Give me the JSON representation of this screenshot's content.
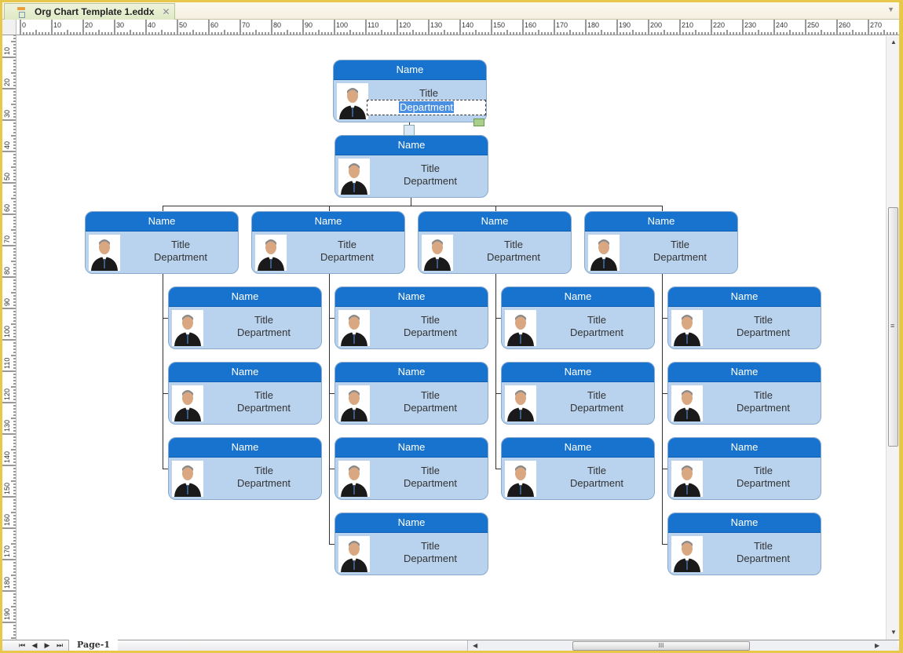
{
  "window": {
    "tab_title": "Org Chart Template 1.eddx",
    "close_glyph": "✕",
    "menu_glyph": "▼"
  },
  "rulers": {
    "horizontal_labels": [
      "0",
      "10",
      "20",
      "30",
      "40",
      "50",
      "60",
      "70",
      "80",
      "90",
      "100",
      "110",
      "120",
      "130",
      "140",
      "150",
      "160",
      "170",
      "180",
      "190",
      "200",
      "210",
      "220",
      "230",
      "240",
      "250",
      "260",
      "270"
    ],
    "vertical_labels": [
      "10",
      "20",
      "30",
      "40",
      "50",
      "60",
      "70",
      "80",
      "90",
      "100",
      "110",
      "120",
      "130",
      "140",
      "150",
      "160",
      "170",
      "180",
      "190"
    ]
  },
  "chart": {
    "root": {
      "name": "Name",
      "title": "Title",
      "department": "Department",
      "editing": true
    },
    "level1": {
      "name": "Name",
      "title": "Title",
      "department": "Department"
    },
    "managers": [
      {
        "name": "Name",
        "title": "Title",
        "department": "Department",
        "reports": [
          {
            "name": "Name",
            "title": "Title",
            "department": "Department"
          },
          {
            "name": "Name",
            "title": "Title",
            "department": "Department"
          },
          {
            "name": "Name",
            "title": "Title",
            "department": "Department"
          }
        ]
      },
      {
        "name": "Name",
        "title": "Title",
        "department": "Department",
        "reports": [
          {
            "name": "Name",
            "title": "Title",
            "department": "Department"
          },
          {
            "name": "Name",
            "title": "Title",
            "department": "Department"
          },
          {
            "name": "Name",
            "title": "Title",
            "department": "Department"
          },
          {
            "name": "Name",
            "title": "Title",
            "department": "Department"
          }
        ]
      },
      {
        "name": "Name",
        "title": "Title",
        "department": "Department",
        "reports": [
          {
            "name": "Name",
            "title": "Title",
            "department": "Department"
          },
          {
            "name": "Name",
            "title": "Title",
            "department": "Department"
          },
          {
            "name": "Name",
            "title": "Title",
            "department": "Department"
          }
        ]
      },
      {
        "name": "Name",
        "title": "Title",
        "department": "Department",
        "reports": [
          {
            "name": "Name",
            "title": "Title",
            "department": "Department"
          },
          {
            "name": "Name",
            "title": "Title",
            "department": "Department"
          },
          {
            "name": "Name",
            "title": "Title",
            "department": "Department"
          },
          {
            "name": "Name",
            "title": "Title",
            "department": "Department"
          }
        ]
      }
    ]
  },
  "bottom": {
    "nav": [
      "⏮",
      "◀",
      "▶",
      "⏭"
    ],
    "page_tab": "Page-1",
    "hscroll_grip": "III",
    "vscroll_grip": "≡"
  },
  "colors": {
    "card_header": "#1873cf",
    "card_body": "#b9d3ef",
    "frame": "#e8c84a"
  }
}
